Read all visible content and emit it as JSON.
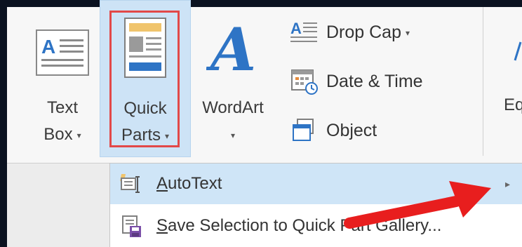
{
  "ribbon": {
    "text_box": {
      "label_line1": "Text",
      "label_line2": "Box",
      "caret": "▾",
      "icon": "text-box-icon"
    },
    "quick_parts": {
      "label_line1": "Quick",
      "label_line2": "Parts",
      "caret": "▾",
      "icon": "quick-parts-icon"
    },
    "wordart": {
      "label": "WordArt",
      "caret": "▾",
      "icon": "wordart-icon"
    },
    "drop_cap": {
      "label": "Drop Cap",
      "caret": "▾",
      "icon": "drop-cap-icon"
    },
    "date_time": {
      "label": "Date & Time",
      "icon": "calendar-clock-icon"
    },
    "object": {
      "label": "Object",
      "icon": "object-icon"
    },
    "equation_partial": {
      "label": "Eq"
    }
  },
  "menu": {
    "items": [
      {
        "label": "AutoText",
        "underline_char": "A",
        "icon": "autotext-icon",
        "has_submenu": true
      },
      {
        "label": "Save Selection to Quick Part Gallery...",
        "underline_char": "S",
        "icon": "save-selection-icon",
        "has_submenu": false
      }
    ]
  },
  "colors": {
    "highlight": "#cde3f6",
    "red_outline": "#e24848",
    "red_arrow": "#e81e1e",
    "wordart_blue": "#2e74c5"
  }
}
